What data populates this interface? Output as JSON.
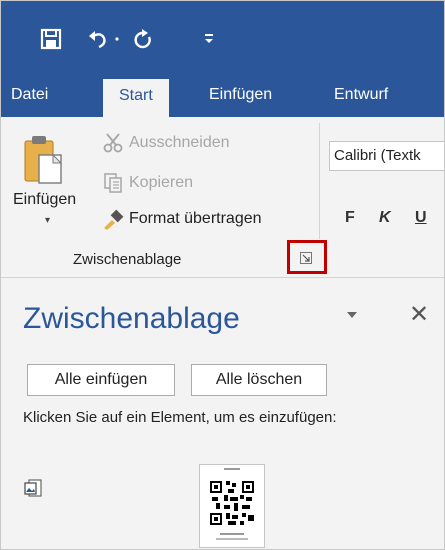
{
  "quick_access": {
    "save_icon": "save-icon",
    "undo_icon": "undo-icon",
    "redo_icon": "redo-icon",
    "customize_icon": "customize-qat-icon"
  },
  "tabs": [
    {
      "label": "Datei",
      "active": false
    },
    {
      "label": "Start",
      "active": true
    },
    {
      "label": "Einfügen",
      "active": false
    },
    {
      "label": "Entwurf",
      "active": false
    }
  ],
  "ribbon": {
    "clipboard_group": {
      "paste_label": "Einfügen",
      "cut_label": "Ausschneiden",
      "copy_label": "Kopieren",
      "format_painter_label": "Format übertragen",
      "group_label": "Zwischenablage"
    },
    "font_group": {
      "font_name": "Calibri (Textk",
      "bold": "F",
      "italic": "K",
      "underline": "U"
    }
  },
  "clipboard_pane": {
    "title": "Zwischenablage",
    "paste_all_label": "Alle einfügen",
    "clear_all_label": "Alle löschen",
    "hint": "Klicken Sie auf ein Element, um es einzufügen:"
  },
  "colors": {
    "brand": "#2b579a",
    "ribbon_bg": "#f3f3f3",
    "highlight": "#c00000"
  }
}
